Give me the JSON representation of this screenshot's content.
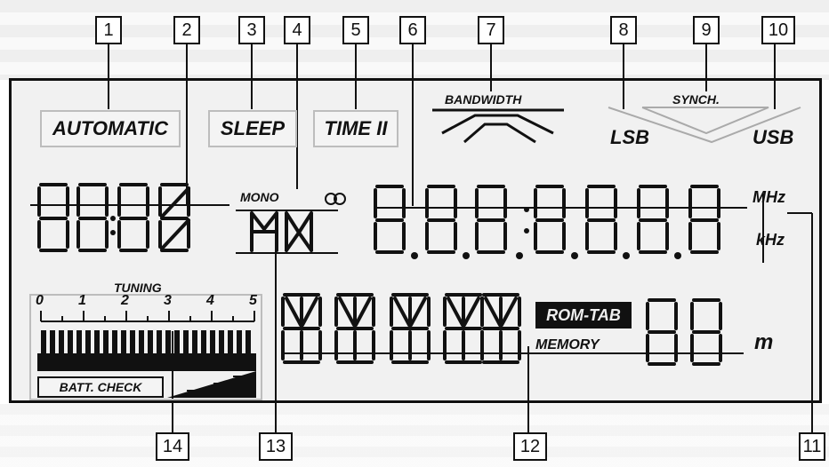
{
  "callouts": [
    "1",
    "2",
    "3",
    "4",
    "5",
    "6",
    "7",
    "8",
    "9",
    "10",
    "11",
    "12",
    "13",
    "14"
  ],
  "labels": {
    "automatic": "AUTOMATIC",
    "sleep": "SLEEP",
    "time2": "TIME II",
    "bandwidth": "BANDWIDTH",
    "synch": "SYNCH.",
    "lsb": "LSB",
    "usb": "USB",
    "mono": "MONO",
    "mhz": "MHz",
    "khz": "kHz",
    "tuning": "TUNING",
    "rom_tab": "ROM-TAB",
    "memory": "MEMORY",
    "meter": "m",
    "batt_check": "BATT. CHECK"
  },
  "tuning_scale": [
    "0",
    "1",
    "2",
    "3",
    "4",
    "5"
  ],
  "colors": {
    "ink": "#111111",
    "panel": "#f1f1f1",
    "box_border": "#bdbdbd"
  }
}
